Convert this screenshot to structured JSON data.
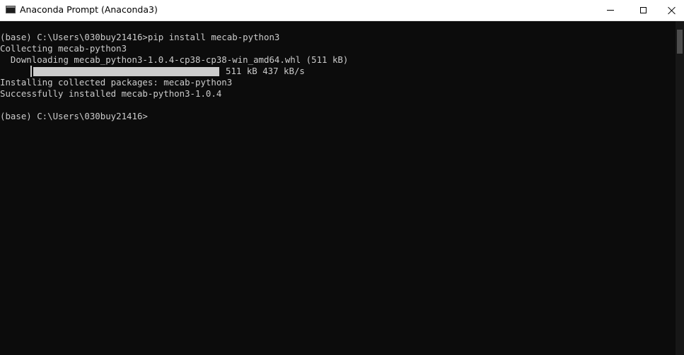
{
  "window": {
    "title": "Anaconda Prompt (Anaconda3)",
    "app_icon": "console-icon",
    "controls": {
      "minimize_icon": "minimize-icon",
      "maximize_icon": "maximize-icon",
      "close_icon": "close-icon"
    }
  },
  "console": {
    "lines": [
      "(base) C:\\Users\\030buy21416>pip install mecab-python3",
      "Collecting mecab-python3",
      "  Downloading mecab_python3-1.0.4-cp38-cp38-win_amd64.whl (511 kB)"
    ],
    "progress": {
      "fraction": 1.0,
      "text": "511 kB 437 kB/s"
    },
    "lines_after": [
      "Installing collected packages: mecab-python3",
      "Successfully installed mecab-python3-1.0.4",
      "",
      "(base) C:\\Users\\030buy21416>"
    ]
  },
  "colors": {
    "console_bg": "#0c0c0c",
    "console_fg": "#cccccc",
    "titlebar_bg": "#ffffff"
  }
}
